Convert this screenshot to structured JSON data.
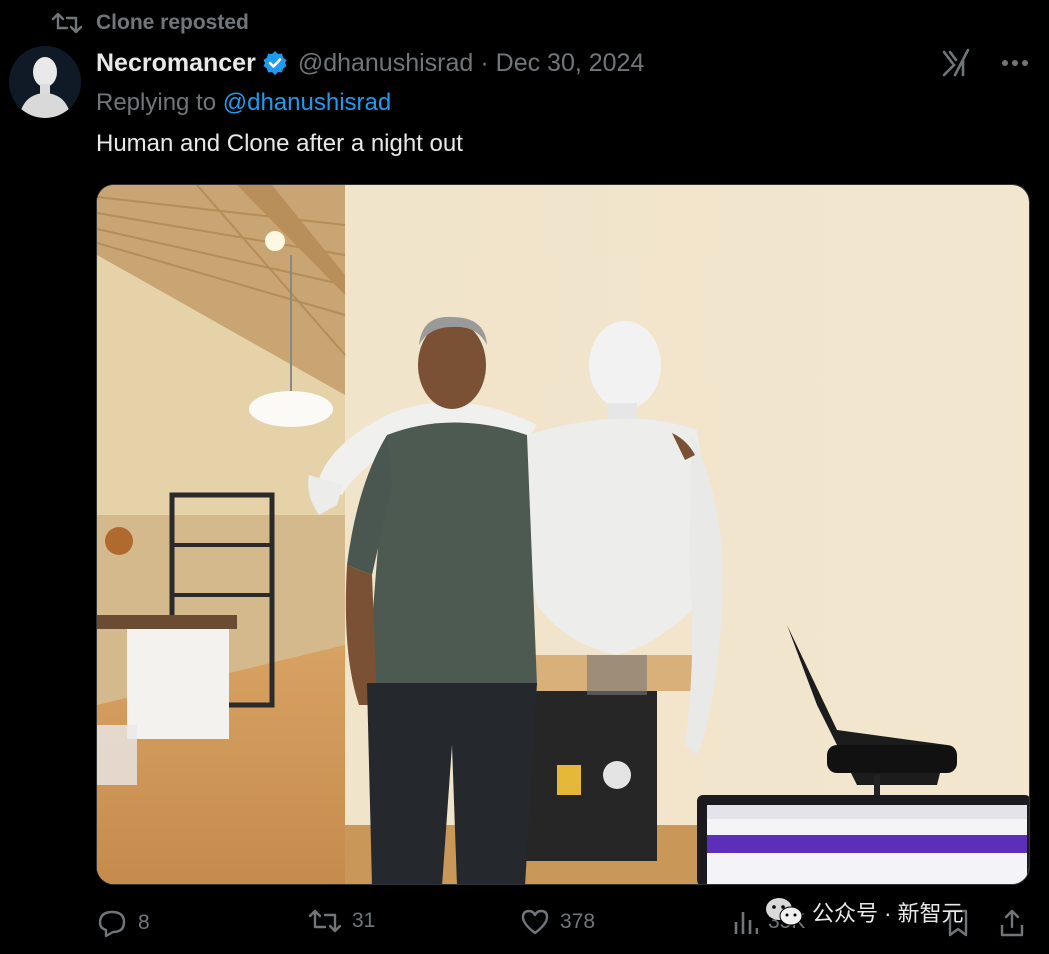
{
  "repost": {
    "label": "Clone reposted"
  },
  "author": {
    "name": "Necromancer",
    "handle": "@dhanushisrad",
    "separator": "·",
    "date": "Dec 30, 2024"
  },
  "reply": {
    "prefix": "Replying to ",
    "mention": "@dhanushisrad"
  },
  "tweet": {
    "text": "Human and Clone after a night out"
  },
  "actions": {
    "replies": "8",
    "reposts": "31",
    "likes": "378",
    "views": "35K"
  },
  "watermark": {
    "text": "公众号 · 新智元"
  },
  "colors": {
    "background": "#000000",
    "accent": "#1d9bf0",
    "muted": "#71767b",
    "text": "#e7e9ea"
  },
  "icons": {
    "repost": "repost-icon",
    "verified": "verified-badge-icon",
    "grok": "grok-icon",
    "more": "more-icon",
    "reply": "reply-icon",
    "like": "heart-icon",
    "views": "views-icon",
    "bookmark": "bookmark-icon",
    "share": "share-icon"
  }
}
